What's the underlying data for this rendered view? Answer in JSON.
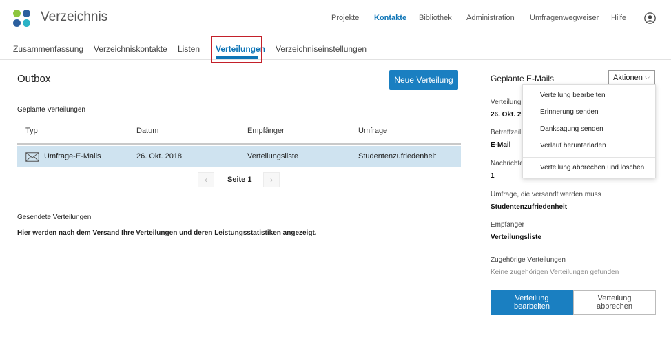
{
  "header": {
    "app_title": "Verzeichnis",
    "nav": [
      "Projekte",
      "Kontakte",
      "Bibliothek",
      "Administration",
      "Umfragenwegweiser",
      "Hilfe"
    ],
    "active_nav": "Kontakte",
    "colors": {
      "accent": "#0e75b7",
      "logo_green": "#8dc63f",
      "logo_blue": "#2b5f9e",
      "logo_cyan": "#2bb3c6"
    }
  },
  "subtabs": [
    "Zusammenfassung",
    "Verzeichniskontakte",
    "Listen",
    "Verteilungen",
    "Verzeichniseinstellungen"
  ],
  "active_subtab": "Verteilungen",
  "main": {
    "title": "Outbox",
    "new_button": "Neue Verteilung",
    "scheduled_label": "Geplante Verteilungen",
    "columns": [
      "Typ",
      "Datum",
      "Empfänger",
      "Umfrage"
    ],
    "rows": [
      {
        "type": "Umfrage-E-Mails",
        "date": "26. Okt. 2018",
        "recipient": "Verteilungsliste",
        "survey": "Studentenzufriedenheit",
        "icon": "envelope-icon"
      }
    ],
    "page_label": "Seite 1",
    "sent_label": "Gesendete Verteilungen",
    "sent_info": "Hier werden nach dem Versand Ihre Verteilungen und deren Leistungsstatistiken angezeigt."
  },
  "panel": {
    "title": "Geplante E-Mails",
    "actions_label": "Aktionen",
    "fields": {
      "distribution_label": "Verteilungs",
      "distribution_value": "26. Okt. 20",
      "subject_label": "Betreffzeil",
      "subject_value": "E-Mail",
      "messages_label": "Nachrichte",
      "messages_value": "1",
      "survey_label": "Umfrage, die versandt werden muss",
      "survey_value": "Studentenzufriedenheit",
      "recipient_label": "Empfänger",
      "recipient_value": "Verteilungsliste",
      "related_label": "Zugehörige Verteilungen",
      "related_value": "Keine zugehörigen Verteilungen gefunden"
    },
    "edit_button_line1": "Verteilung",
    "edit_button_line2": "bearbeiten",
    "cancel_button_line1": "Verteilung",
    "cancel_button_line2": "abbrechen"
  },
  "dropdown": {
    "items": [
      "Verteilung bearbeiten",
      "Erinnerung senden",
      "Danksagung senden",
      "Verlauf herunterladen"
    ],
    "danger_item": "Verteilung abbrechen und löschen"
  }
}
